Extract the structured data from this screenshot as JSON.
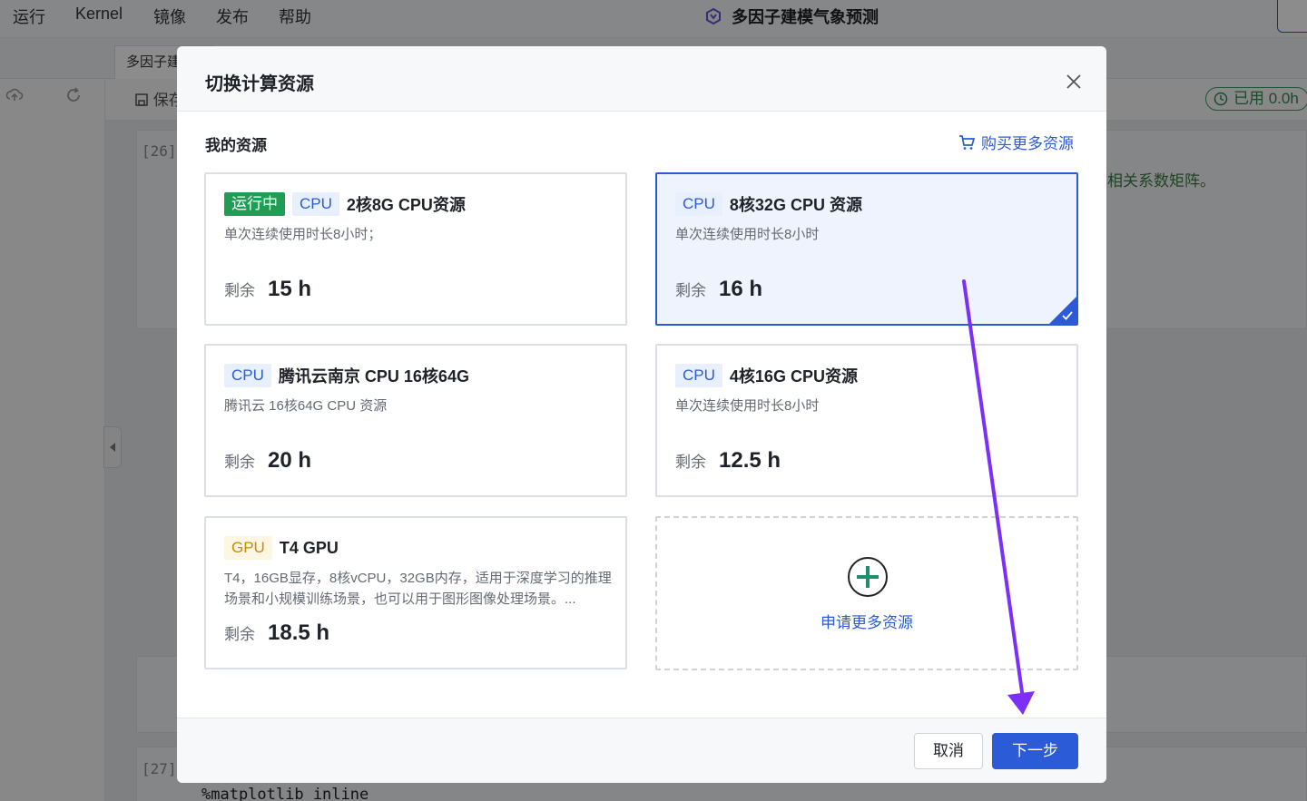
{
  "menubar": {
    "items": [
      "运行",
      "Kernel",
      "镜像",
      "发布",
      "帮助"
    ],
    "app_title": "多因子建模气象预测"
  },
  "tabs": {
    "active_tab": "多因子建"
  },
  "toolbar": {
    "save_label": "保存",
    "usage_label": "已用 0.0h"
  },
  "notebook": {
    "cell_prompts": [
      "[26]",
      "[27]"
    ],
    "cell_note": "相关系数矩阵。",
    "code_line": "%matplotlib inline"
  },
  "modal": {
    "title": "切换计算资源",
    "section_title": "我的资源",
    "buy_more_label": "购买更多资源",
    "remaining_label": "剩余",
    "cards": [
      {
        "status_tag": "运行中",
        "type_tag": "CPU",
        "name": "2核8G CPU资源",
        "description": "单次连续使用时长8小时；",
        "remaining": "15 h",
        "selected": false
      },
      {
        "status_tag": "",
        "type_tag": "CPU",
        "name": "8核32G CPU 资源",
        "description": "单次连续使用时长8小时",
        "remaining": "16 h",
        "selected": true
      },
      {
        "status_tag": "",
        "type_tag": "CPU",
        "name": "腾讯云南京 CPU 16核64G",
        "description": "腾讯云 16核64G CPU 资源",
        "remaining": "20 h",
        "selected": false
      },
      {
        "status_tag": "",
        "type_tag": "CPU",
        "name": "4核16G CPU资源",
        "description": "单次连续使用时长8小时",
        "remaining": "12.5 h",
        "selected": false
      },
      {
        "status_tag": "",
        "type_tag": "GPU",
        "name": "T4 GPU",
        "description": "T4，16GB显存，8核vCPU，32GB内存，适用于深度学习的推理场景和小规模训练场景，也可以用于图形图像处理场景。...",
        "remaining": "18.5 h",
        "selected": false
      }
    ],
    "add_resource_label": "申请更多资源",
    "cancel_label": "取消",
    "next_label": "下一步"
  },
  "colors": {
    "accent": "#2b5bd7",
    "running": "#1f9d55",
    "gpu_tag": "#c98a0a",
    "annotation_arrow": "#7b2ff7"
  },
  "icons": [
    "logo-icon",
    "cloud-upload-icon",
    "refresh-icon",
    "save-icon",
    "clock-icon",
    "close-icon",
    "cart-icon",
    "check-icon",
    "plus-circle-icon",
    "collapse-icon"
  ]
}
